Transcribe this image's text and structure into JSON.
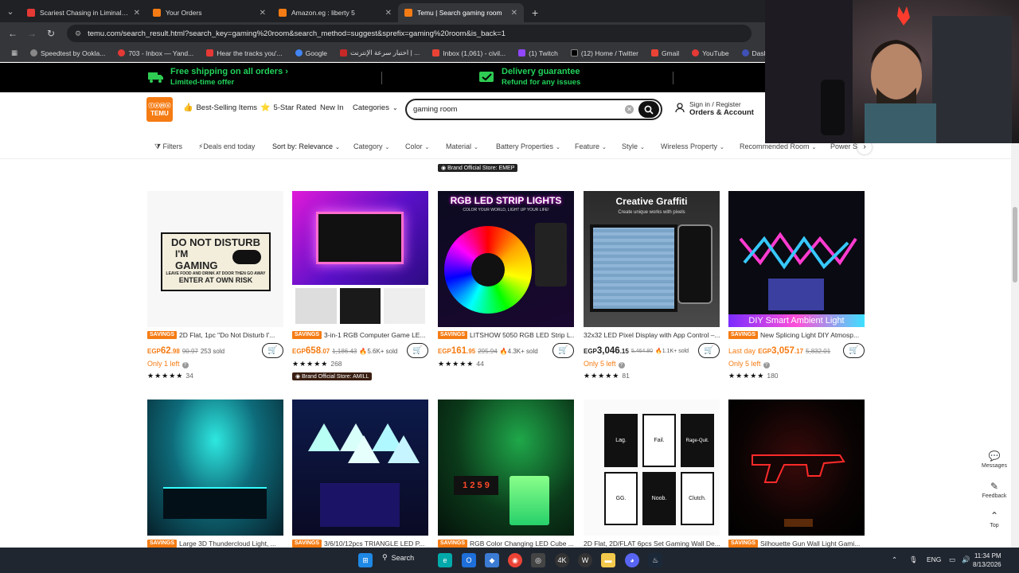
{
  "browser": {
    "tabs": [
      {
        "title": "Scariest Chasing in Liminal Hote",
        "color": "#e53935",
        "active": false
      },
      {
        "title": "Your Orders",
        "color": "#f57c14",
        "active": false
      },
      {
        "title": "Amazon.eg : liberty 5",
        "color": "#f57c14",
        "active": false
      },
      {
        "title": "Temu | Search gaming room",
        "color": "#f57c14",
        "active": true
      }
    ],
    "url": "temu.com/search_result.html?search_key=gaming%20room&search_method=suggest&sprefix=gaming%20room&is_back=1",
    "bookmarks": [
      {
        "label": "Speedtest by Ookla...",
        "color": "#888"
      },
      {
        "label": "703 - Inbox — Yand...",
        "color": "#e53935"
      },
      {
        "label": "Hear the tracks you'...",
        "color": "#e53935"
      },
      {
        "label": "Google",
        "color": "#4285f4"
      },
      {
        "label": "اختبار سرعة الإنترنت | ...",
        "color": "#c62828"
      },
      {
        "label": "Inbox (1,061) - civil...",
        "color": "#ea4335"
      },
      {
        "label": "(1) Twitch",
        "color": "#9146ff"
      },
      {
        "label": "(12) Home / Twitter",
        "color": "#000"
      },
      {
        "label": "Gmail",
        "color": "#ea4335"
      },
      {
        "label": "YouTube",
        "color": "#e53935"
      },
      {
        "label": "Dashboard - Restre...",
        "color": "#3f51b5"
      }
    ]
  },
  "promo": {
    "shipping_title": "Free shipping on all orders",
    "shipping_sub": "Limited-time offer",
    "delivery_title": "Delivery guarantee",
    "delivery_sub": "Refund for any issues"
  },
  "header": {
    "logo_text": "TEMU",
    "nav": [
      "Best-Selling Items",
      "5-Star Rated",
      "New In",
      "Categories"
    ],
    "search_value": "gaming room",
    "account_line1": "Sign in / Register",
    "account_line2": "Orders & Account"
  },
  "filters": [
    "Filters",
    "Deals end today",
    "Sort by: Relevance",
    "Category",
    "Color",
    "Material",
    "Battery Properties",
    "Feature",
    "Style",
    "Wireless Property",
    "Recommended Room",
    "Power S"
  ],
  "top_brand_tag": "Brand Official Store: EMEP",
  "savings_label": "SAVINGS",
  "products_row1": [
    {
      "title": "2D Flat, 1pc \"Do Not Disturb I'...",
      "savings": true,
      "currency": "EGP",
      "price": "62",
      "cents": ".98",
      "orig": "90.97",
      "sold": "253 sold",
      "hot": false,
      "stock": "Only 1 left",
      "stars": "★★★★★",
      "reviews": "34",
      "brand": ""
    },
    {
      "title": "3-in-1 RGB Computer Game LE...",
      "savings": true,
      "currency": "EGP",
      "price": "658",
      "cents": ".07",
      "orig": "1,186.43",
      "sold": "5.6K+ sold",
      "hot": true,
      "stock": "",
      "stars": "★★★★★",
      "reviews": "268",
      "brand": "Brand Official Store: AMILL"
    },
    {
      "title": "LITSHOW 5050 RGB LED Strip L...",
      "savings": true,
      "currency": "EGP",
      "price": "161",
      "cents": ".95",
      "orig": "295.94",
      "sold": "4.3K+ sold",
      "hot": true,
      "stock": "",
      "stars": "★★★★★",
      "reviews": "44",
      "brand": ""
    },
    {
      "title": "32x32 LED Pixel Display with App Control –...",
      "savings": false,
      "currency": "EGP",
      "price": "3,046",
      "cents": ".15",
      "orig": "5,464.80",
      "sold": "1.1K+ sold",
      "hot": true,
      "stock": "Only 5 left",
      "stars": "★★★★★",
      "reviews": "81",
      "brand": ""
    },
    {
      "title": "New Splicing Light DIY Atmosp...",
      "savings": true,
      "currency": "EGP",
      "prefix": "Last day",
      "price": "3,057",
      "cents": ".17",
      "orig": "5,832.01",
      "sold": "",
      "hot": false,
      "stock": "Only 5 left",
      "stars": "★★★★★",
      "reviews": "180",
      "brand": ""
    }
  ],
  "products_row2": [
    {
      "title": "Large 3D Thundercloud Light, ...",
      "savings": true
    },
    {
      "title": "3/6/10/12pcs TRIANGLE LED P...",
      "savings": true
    },
    {
      "title": "RGB Color Changing LED Cube ...",
      "savings": true
    },
    {
      "title": "2D Flat, 2D/FLAT 6pcs Set Gaming Wall De...",
      "savings": false
    },
    {
      "title": "Silhouette Gun Wall Light Gami...",
      "savings": true
    }
  ],
  "image_text": {
    "p1_line1": "DO NOT DISTURB",
    "p1_line2": "I'M",
    "p1_line3": "GAMING",
    "p1_line4": "LEAVE FOOD AND DRINK AT DOOR THEN GO AWAY",
    "p1_line5": "ENTER AT OWN RISK",
    "p3_title": "RGB LED STRIP LIGHTS",
    "p3_sub": "COLOR YOUR WORLD, LIGHT UP YOUR LIFE!",
    "p4_title": "Creative Graffiti",
    "p4_sub": "Create unique works with pixels",
    "p5_banner": "DIY Smart Ambient Light",
    "r2p3_clock": "1 2 5 9",
    "frames": [
      "Lag.",
      "Fail.",
      "Rage-Quit.",
      "GG.",
      "Noob.",
      "Clutch."
    ]
  },
  "side_widgets": [
    "Messages",
    "Feedback",
    "Top"
  ],
  "taskbar": {
    "search": "Search",
    "lang": "ENG",
    "time": "11:34 PM",
    "date": "8/13/2026"
  }
}
